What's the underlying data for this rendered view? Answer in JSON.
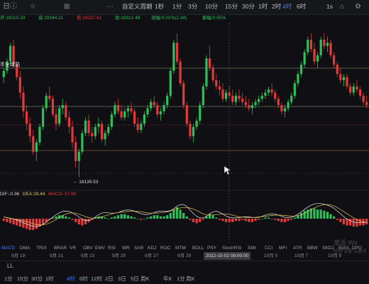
{
  "toolbar": {
    "items": [
      "日",
      "ⓘ",
      "☆",
      "⊞",
      "⋯",
      "自定义周期",
      "1秒",
      "1分",
      "3分",
      "10分",
      "15分",
      "30分",
      "1时",
      "2时",
      "4时",
      "6时",
      "1s"
    ],
    "active_index": 14
  },
  "info": {
    "open": "开:19310.33",
    "high": "高:19344.21",
    "low": "低:19237.61",
    "close": "收:19312.48",
    "change": "涨幅:0.01%(2.34)",
    "amplitude": "振幅:0.55%"
  },
  "symbol_label": "币全球站",
  "low_marker": "← 18139.53",
  "macd": {
    "dif": "DIF:-0.36",
    "dea": "DEA:28.44",
    "macd": "MACD:-57.60"
  },
  "indicator_tabs": [
    "MACD",
    "DMA",
    "TRIX",
    "BRAR",
    "VR",
    "OBV",
    "EMV",
    "RSI",
    "WR",
    "SAR",
    "KDJ",
    "ROC",
    "MTM",
    "BOLL",
    "PSY",
    "StochRSI",
    "SMI",
    "CCI",
    "MFI",
    "ATR",
    "BBW",
    "SKDJ",
    "BIAS",
    "DPO",
    "AO",
    "Position"
  ],
  "active_indicator": 0,
  "x_dates": [
    "9月 19",
    "9月 21",
    "9月 23",
    "9月 25",
    "9月 27",
    "9月 29",
    "10月 5",
    "10月 7",
    "10月 9"
  ],
  "cursor_date": "2022-10-02 08:00:00",
  "bottom": {
    "label": "LL",
    "periods": [
      "1分",
      "15分",
      "30分",
      "1时",
      "4时",
      "6时",
      "12时",
      "2日",
      "3日",
      "5日",
      "周K",
      "年K",
      "1分",
      "周K"
    ],
    "active_index": 4
  },
  "watermark": {
    "line1": "激活 Wir",
    "line2": "转到\"设置\"以激活"
  },
  "colors": {
    "up": "#2fbe5a",
    "down": "#e23a3a",
    "accent": "#3d7bff",
    "background": "#101014"
  },
  "chart_data": {
    "type": "candlestick",
    "price_low_marked": 18139.53,
    "candles": [
      [
        19750,
        19900,
        19650,
        19850
      ],
      [
        19850,
        20050,
        19800,
        20000
      ],
      [
        20000,
        20300,
        19950,
        20250
      ],
      [
        20250,
        20350,
        19900,
        19950
      ],
      [
        19950,
        20000,
        19700,
        19750
      ],
      [
        19750,
        19850,
        19400,
        19500
      ],
      [
        19500,
        19600,
        19100,
        19200
      ],
      [
        19200,
        19300,
        18900,
        19000
      ],
      [
        19000,
        19100,
        18700,
        18800
      ],
      [
        18800,
        18900,
        18500,
        18550
      ],
      [
        18550,
        18750,
        18400,
        18700
      ],
      [
        18700,
        19000,
        18650,
        18950
      ],
      [
        18950,
        19300,
        18900,
        19250
      ],
      [
        19250,
        19500,
        19200,
        19450
      ],
      [
        19450,
        19600,
        19350,
        19400
      ],
      [
        19400,
        19450,
        19100,
        19150
      ],
      [
        19150,
        19250,
        18900,
        19000
      ],
      [
        19000,
        19300,
        18950,
        19250
      ],
      [
        19250,
        19400,
        19150,
        19300
      ],
      [
        19300,
        19350,
        19050,
        19100
      ],
      [
        19100,
        19200,
        18850,
        18950
      ],
      [
        18950,
        19050,
        18600,
        18700
      ],
      [
        18700,
        18800,
        18300,
        18400
      ],
      [
        18400,
        18600,
        18140,
        18550
      ],
      [
        18550,
        18900,
        18500,
        18850
      ],
      [
        18850,
        19100,
        18800,
        19050
      ],
      [
        19050,
        19150,
        18800,
        18850
      ],
      [
        18850,
        18950,
        18700,
        18800
      ],
      [
        18800,
        19000,
        18750,
        18950
      ],
      [
        18950,
        19100,
        18850,
        19000
      ],
      [
        19000,
        19050,
        18700,
        18750
      ],
      [
        18750,
        18900,
        18650,
        18850
      ],
      [
        18850,
        19000,
        18800,
        18950
      ],
      [
        18950,
        19200,
        18900,
        19150
      ],
      [
        19150,
        19350,
        19100,
        19300
      ],
      [
        19300,
        19400,
        19150,
        19200
      ],
      [
        19200,
        19300,
        19050,
        19100
      ],
      [
        19100,
        19250,
        19050,
        19200
      ],
      [
        19200,
        19300,
        19100,
        19250
      ],
      [
        19250,
        19350,
        19150,
        19200
      ],
      [
        19200,
        19250,
        18950,
        19000
      ],
      [
        19000,
        19100,
        18850,
        18900
      ],
      [
        18900,
        19050,
        18850,
        19000
      ],
      [
        19000,
        19200,
        18950,
        19150
      ],
      [
        19150,
        19300,
        19100,
        19250
      ],
      [
        19250,
        19400,
        19200,
        19350
      ],
      [
        19350,
        19450,
        19250,
        19300
      ],
      [
        19300,
        19350,
        19100,
        19150
      ],
      [
        19150,
        19250,
        19050,
        19200
      ],
      [
        19200,
        19350,
        19150,
        19300
      ],
      [
        19300,
        19500,
        19250,
        19450
      ],
      [
        19450,
        19900,
        19400,
        19850
      ],
      [
        19850,
        20350,
        19800,
        20300
      ],
      [
        20300,
        20450,
        19950,
        20000
      ],
      [
        20000,
        20050,
        19600,
        19650
      ],
      [
        19650,
        19700,
        19250,
        19300
      ],
      [
        19300,
        19350,
        18950,
        19000
      ],
      [
        19000,
        19050,
        18750,
        18800
      ],
      [
        18800,
        19000,
        18700,
        18950
      ],
      [
        18950,
        19100,
        18900,
        19050
      ],
      [
        19050,
        19350,
        19000,
        19300
      ],
      [
        19300,
        19650,
        19250,
        19600
      ],
      [
        19600,
        20100,
        19550,
        20050
      ],
      [
        20050,
        20250,
        19850,
        19900
      ],
      [
        19900,
        19950,
        19650,
        19700
      ],
      [
        19700,
        19800,
        19550,
        19600
      ],
      [
        19600,
        19700,
        19450,
        19550
      ],
      [
        19550,
        19650,
        19350,
        19400
      ],
      [
        19400,
        19550,
        19350,
        19500
      ],
      [
        19500,
        19600,
        19400,
        19450
      ],
      [
        19450,
        19550,
        19300,
        19350
      ],
      [
        19350,
        19500,
        19300,
        19450
      ],
      [
        19450,
        19550,
        19350,
        19400
      ],
      [
        19400,
        19500,
        19300,
        19350
      ],
      [
        19350,
        19450,
        19250,
        19300
      ],
      [
        19300,
        19400,
        19200,
        19250
      ],
      [
        19250,
        19350,
        19150,
        19300
      ],
      [
        19300,
        19400,
        19250,
        19350
      ],
      [
        19350,
        19450,
        19300,
        19400
      ],
      [
        19400,
        19500,
        19350,
        19450
      ],
      [
        19450,
        19550,
        19400,
        19500
      ],
      [
        19500,
        19600,
        19450,
        19550
      ],
      [
        19550,
        19650,
        19450,
        19500
      ],
      [
        19500,
        19550,
        19350,
        19400
      ],
      [
        19400,
        19450,
        19250,
        19300
      ],
      [
        19300,
        19350,
        19150,
        19200
      ],
      [
        19200,
        19300,
        19100,
        19250
      ],
      [
        19250,
        19400,
        19200,
        19350
      ],
      [
        19350,
        19500,
        19300,
        19450
      ],
      [
        19450,
        19700,
        19400,
        19650
      ],
      [
        19650,
        19850,
        19600,
        19800
      ],
      [
        19800,
        20000,
        19750,
        19950
      ],
      [
        19950,
        20200,
        19900,
        20150
      ],
      [
        20150,
        20400,
        20100,
        20350
      ],
      [
        20350,
        20450,
        20150,
        20200
      ],
      [
        20200,
        20300,
        19950,
        20000
      ],
      [
        20000,
        20150,
        19900,
        20100
      ],
      [
        20100,
        20400,
        20050,
        20350
      ],
      [
        20350,
        20450,
        20200,
        20250
      ],
      [
        20250,
        20400,
        20150,
        20300
      ],
      [
        20300,
        20350,
        20050,
        20100
      ],
      [
        20100,
        20150,
        19900,
        19950
      ],
      [
        19950,
        20000,
        19750,
        19800
      ],
      [
        19800,
        19900,
        19650,
        19700
      ],
      [
        19700,
        19800,
        19600,
        19750
      ],
      [
        19750,
        19800,
        19550,
        19600
      ],
      [
        19600,
        19650,
        19450,
        19500
      ],
      [
        19500,
        19650,
        19450,
        19600
      ],
      [
        19600,
        19700,
        19500,
        19550
      ],
      [
        19550,
        19600,
        19400,
        19450
      ],
      [
        19450,
        19500,
        19300,
        19350
      ],
      [
        19350,
        19450,
        19250,
        19300
      ]
    ]
  }
}
